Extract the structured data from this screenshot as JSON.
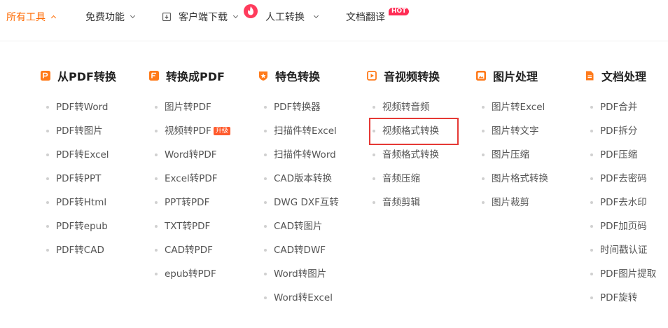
{
  "colors": {
    "accent": "#ff6a00",
    "hot_badge": "#ff2d55",
    "upgrade_badge": "#ff5a2c",
    "highlight_border": "#e53935"
  },
  "nav": {
    "all_tools": "所有工具",
    "free": "免费功能",
    "client_download": "客户端下载",
    "manual": "人工转换",
    "translate": "文档翻译",
    "hot": "HOT"
  },
  "columns": [
    {
      "title": "从PDF转换",
      "icon": "pdf-convert-icon",
      "items": [
        {
          "label": "PDF转Word"
        },
        {
          "label": "PDF转图片"
        },
        {
          "label": "PDF转Excel"
        },
        {
          "label": "PDF转PPT"
        },
        {
          "label": "PDF转Html"
        },
        {
          "label": "PDF转epub"
        },
        {
          "label": "PDF转CAD"
        }
      ]
    },
    {
      "title": "转换成PDF",
      "icon": "to-pdf-icon",
      "items": [
        {
          "label": "图片转PDF"
        },
        {
          "label": "视频转PDF",
          "badge": "升级"
        },
        {
          "label": "Word转PDF"
        },
        {
          "label": "Excel转PDF"
        },
        {
          "label": "PPT转PDF"
        },
        {
          "label": "TXT转PDF"
        },
        {
          "label": "CAD转PDF"
        },
        {
          "label": "epub转PDF"
        }
      ]
    },
    {
      "title": "特色转换",
      "icon": "star-shield-icon",
      "items": [
        {
          "label": "PDF转换器"
        },
        {
          "label": "扫描件转Excel"
        },
        {
          "label": "扫描件转Word"
        },
        {
          "label": "CAD版本转换"
        },
        {
          "label": "DWG DXF互转"
        },
        {
          "label": "CAD转图片"
        },
        {
          "label": "CAD转DWF"
        },
        {
          "label": "Word转图片"
        },
        {
          "label": "Word转Excel"
        }
      ]
    },
    {
      "title": "音视频转换",
      "icon": "play-video-icon",
      "items": [
        {
          "label": "视频转音频"
        },
        {
          "label": "视频格式转换"
        },
        {
          "label": "音频格式转换"
        },
        {
          "label": "音频压缩"
        },
        {
          "label": "音频剪辑"
        }
      ]
    },
    {
      "title": "图片处理",
      "icon": "image-icon",
      "items": [
        {
          "label": "图片转Excel"
        },
        {
          "label": "图片转文字"
        },
        {
          "label": "图片压缩"
        },
        {
          "label": "图片格式转换"
        },
        {
          "label": "图片裁剪"
        }
      ]
    },
    {
      "title": "文档处理",
      "icon": "document-icon",
      "items": [
        {
          "label": "PDF合并"
        },
        {
          "label": "PDF拆分"
        },
        {
          "label": "PDF压缩"
        },
        {
          "label": "PDF去密码"
        },
        {
          "label": "PDF去水印"
        },
        {
          "label": "PDF加页码"
        },
        {
          "label": "时间戳认证"
        },
        {
          "label": "PDF图片提取"
        },
        {
          "label": "PDF旋转"
        }
      ]
    }
  ]
}
